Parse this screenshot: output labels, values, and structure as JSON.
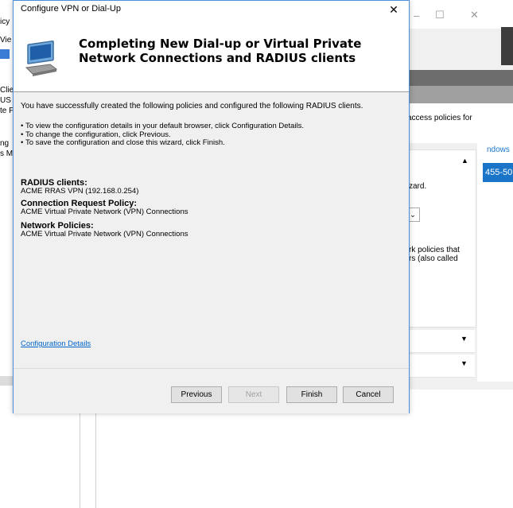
{
  "background_window": {
    "left_fragments": [
      "icy",
      "Vie",
      "Clier",
      "US C",
      "te F",
      "ng",
      "s M"
    ],
    "right_fragments": {
      "access_policies": "access policies for",
      "wizard": "zard.",
      "network_policies_1": "rk policies that",
      "network_policies_2": "rs (also called",
      "windows": "ndows",
      "tab_value": "455-50"
    }
  },
  "dialog": {
    "window_title": "Configure VPN or Dial-Up",
    "close_glyph": "✕",
    "header_title": "Completing New Dial-up or Virtual Private Network Connections and RADIUS clients",
    "intro": "You have successfully created the following policies and configured the following RADIUS clients.",
    "bullets": [
      "To view the configuration details in your default browser, click Configuration Details.",
      "To change the configuration, click Previous.",
      "To save the configuration and close this wizard, click Finish."
    ],
    "sections": [
      {
        "title": "RADIUS clients:",
        "value": "ACME RRAS VPN (192.168.0.254)"
      },
      {
        "title": "Connection Request Policy:",
        "value": "ACME Virtual Private Network (VPN) Connections"
      },
      {
        "title": "Network Policies:",
        "value": "ACME Virtual Private Network (VPN) Connections"
      }
    ],
    "config_details_link": "Configuration Details",
    "buttons": {
      "previous": "Previous",
      "next": "Next",
      "finish": "Finish",
      "cancel": "Cancel"
    }
  },
  "colors": {
    "accent_border": "#4c8fd6",
    "link": "#0066cc",
    "tab_blue": "#1a75c9"
  }
}
